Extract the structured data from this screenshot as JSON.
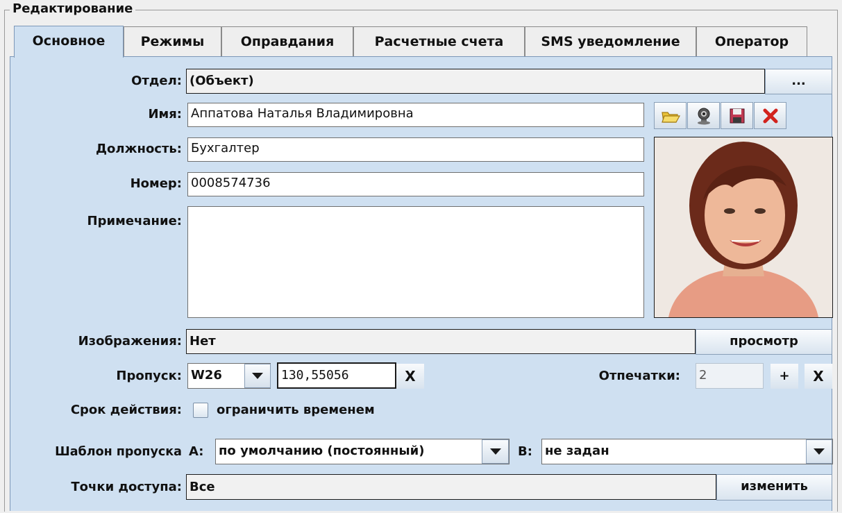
{
  "group_title": "Редактирование",
  "tabs": [
    {
      "label": "Основное",
      "active": true
    },
    {
      "label": "Режимы"
    },
    {
      "label": "Оправдания"
    },
    {
      "label": "Расчетные счета"
    },
    {
      "label": "SMS уведомление"
    },
    {
      "label": "Оператор"
    }
  ],
  "form": {
    "department": {
      "label": "Отдел:",
      "value": "(Объект)",
      "browse_label": "..."
    },
    "name": {
      "label": "Имя:",
      "value": "Аппатова Наталья Владимировна"
    },
    "position": {
      "label": "Должность:",
      "value": "Бухгалтер"
    },
    "number": {
      "label": "Номер:",
      "value": "0008574736"
    },
    "note": {
      "label": "Примечание:",
      "value": ""
    },
    "images": {
      "label": "Изображения:",
      "value": "Нет",
      "button_label": "просмотр"
    },
    "pass": {
      "label": "Пропуск:",
      "format": "W26",
      "code": "130,55056",
      "clear_label": "X"
    },
    "fingerprints": {
      "label": "Отпечатки:",
      "value": "2",
      "add_label": "+",
      "remove_label": "X"
    },
    "validity": {
      "label": "Срок действия:",
      "checkbox_label": "ограничить временем",
      "checked": false
    },
    "template": {
      "label": "Шаблон пропуска",
      "a_label": "A:",
      "a_value": "по умолчанию (постоянный)",
      "b_label": "B:",
      "b_value": "не задан"
    },
    "access_points": {
      "label": "Точки доступа:",
      "value": "Все",
      "button_label": "изменить"
    }
  },
  "photo_toolbar": [
    "open-folder-icon",
    "webcam-icon",
    "save-disk-icon",
    "delete-x-icon"
  ],
  "colors": {
    "panel": "#cfe0f1",
    "delete": "#d2231d"
  }
}
